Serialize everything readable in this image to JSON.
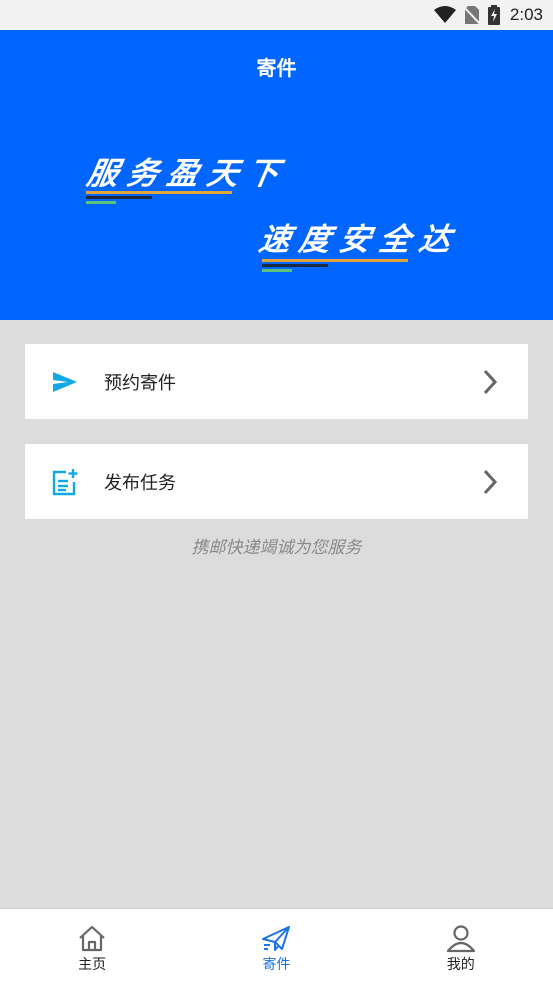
{
  "status_bar": {
    "time": "2:03",
    "icons": [
      "wifi-icon",
      "no-sim-icon",
      "battery-charging-icon"
    ]
  },
  "header": {
    "title": "寄件",
    "slogan_line1": "服务盈天下",
    "slogan_line2": "速度安全达",
    "background_color": "#0066ff"
  },
  "menu": [
    {
      "label": "预约寄件",
      "icon": "send-icon",
      "chevron": "chevron-right-icon"
    },
    {
      "label": "发布任务",
      "icon": "post-add-icon",
      "chevron": "chevron-right-icon"
    }
  ],
  "tagline": "携邮快递竭诚为您服务",
  "bottom_nav": {
    "items": [
      {
        "label": "主页",
        "icon": "home-icon",
        "active": false
      },
      {
        "label": "寄件",
        "icon": "paper-plane-icon",
        "active": true
      },
      {
        "label": "我的",
        "icon": "user-icon",
        "active": false
      }
    ],
    "active_color": "#1a73e8"
  }
}
